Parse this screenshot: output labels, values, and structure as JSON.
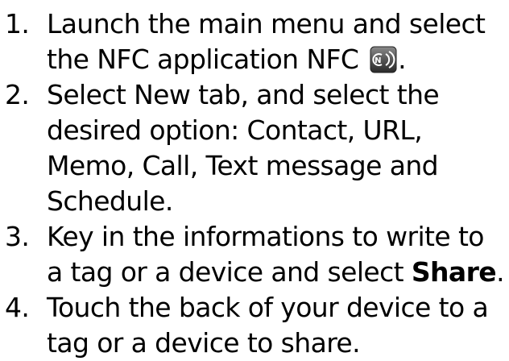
{
  "steps": [
    {
      "number": "1.",
      "line1": "Launch the main menu and select",
      "line2_before_icon": "the NFC application NFC ",
      "icon": "nfc-app-icon",
      "line2_after_icon": "."
    },
    {
      "number": "2.",
      "lines": [
        "Select New tab, and select the",
        "desired option: Contact, URL,",
        "Memo, Call, Text message and",
        "Schedule."
      ]
    },
    {
      "number": "3.",
      "line1": "Key in the informations to write to",
      "line2_before_bold": "a tag or a device and select ",
      "line2_bold": "Share",
      "line2_after_bold": "."
    },
    {
      "number": "4.",
      "lines": [
        "Touch the back of your device to a",
        "tag or a device to share."
      ]
    }
  ]
}
